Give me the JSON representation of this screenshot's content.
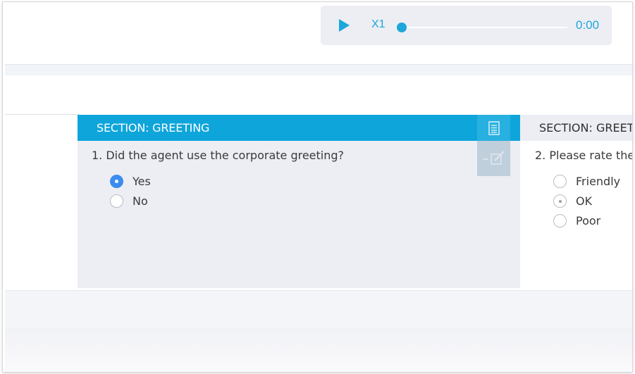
{
  "player": {
    "speed_label": "X1",
    "time": "0:00",
    "progress": 0,
    "accent_color": "#1ea6d9",
    "play_icon": "play-icon"
  },
  "section1": {
    "title": "SECTION: GREETING",
    "question": "1. Did the agent use the corporate greeting?",
    "options": [
      {
        "label": "Yes",
        "selected": true
      },
      {
        "label": "No",
        "selected": false
      }
    ],
    "tools": [
      "notes-icon",
      "edit-icon"
    ],
    "header_color": "#0ea5db"
  },
  "section2": {
    "title": "SECTION: GREET",
    "question": "2. Please rate the",
    "options": [
      {
        "label": "Friendly",
        "selected": false
      },
      {
        "label": "OK",
        "selected": true
      },
      {
        "label": "Poor",
        "selected": false
      }
    ]
  }
}
